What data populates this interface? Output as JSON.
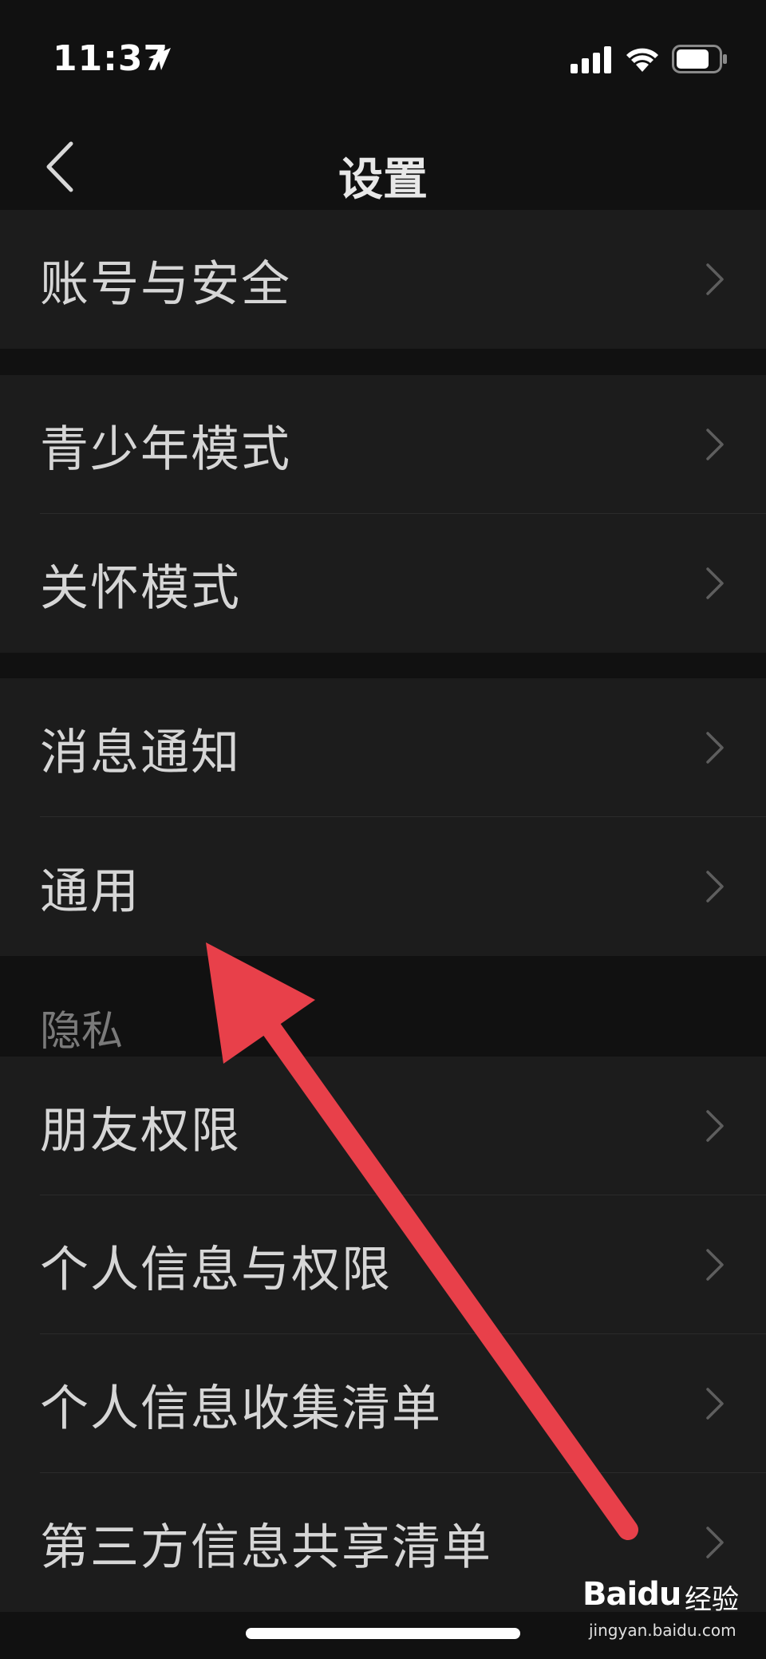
{
  "status_bar": {
    "time": "11:37"
  },
  "nav": {
    "title": "设置"
  },
  "groups": {
    "account": [
      "账号与安全"
    ],
    "modes": [
      "青少年模式",
      "关怀模式"
    ],
    "general": [
      "消息通知",
      "通用"
    ],
    "privacy": [
      "朋友权限",
      "个人信息与权限",
      "个人信息收集清单",
      "第三方信息共享清单"
    ]
  },
  "sections": {
    "privacy_header": "隐私"
  },
  "watermark": {
    "brand": "Baidu",
    "cn": "经验",
    "url": "jingyan.baidu.com"
  },
  "colors": {
    "background": "#111111",
    "row": "#1c1c1c",
    "arrow": "#e8404a"
  },
  "icons": {
    "back": "chevron-left-icon",
    "row": "chevron-right-icon",
    "annotation": "red-arrow-icon"
  }
}
